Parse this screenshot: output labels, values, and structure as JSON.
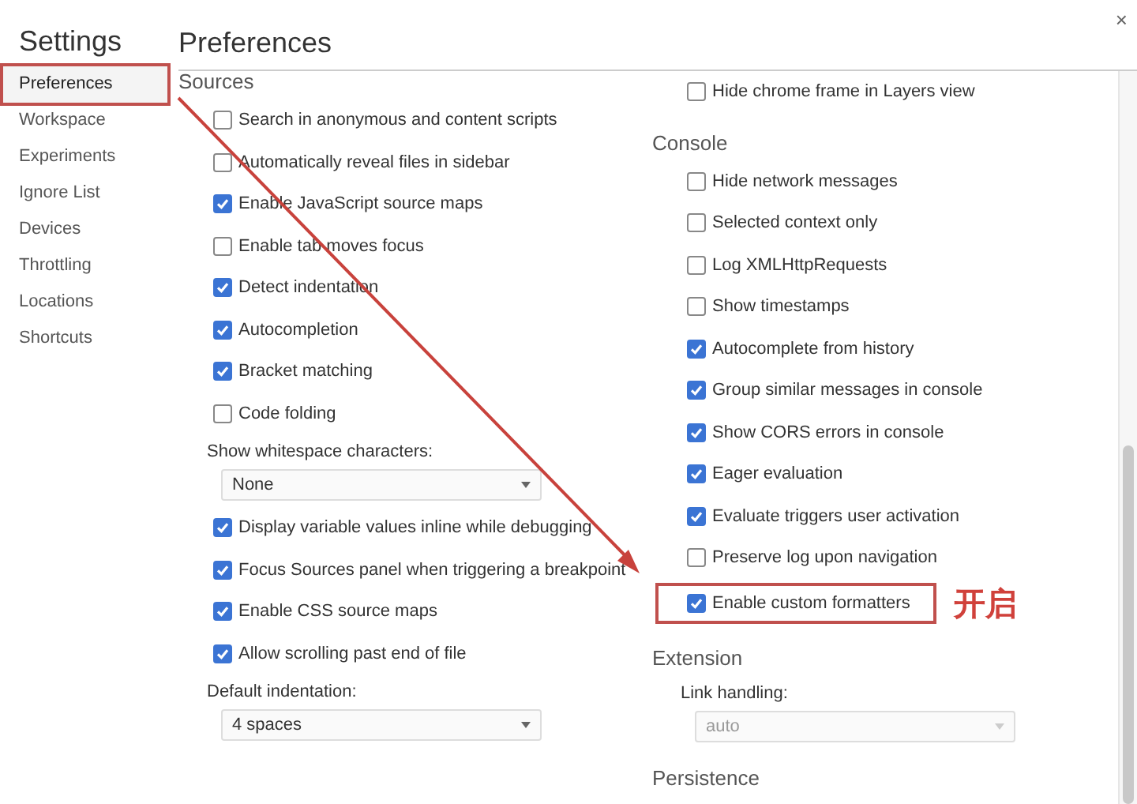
{
  "sidebar": {
    "title": "Settings",
    "items": [
      {
        "label": "Preferences",
        "selected": true,
        "highlighted": true
      },
      {
        "label": "Workspace",
        "selected": false,
        "highlighted": false
      },
      {
        "label": "Experiments",
        "selected": false,
        "highlighted": false
      },
      {
        "label": "Ignore List",
        "selected": false,
        "highlighted": false
      },
      {
        "label": "Devices",
        "selected": false,
        "highlighted": false
      },
      {
        "label": "Throttling",
        "selected": false,
        "highlighted": false
      },
      {
        "label": "Locations",
        "selected": false,
        "highlighted": false
      },
      {
        "label": "Shortcuts",
        "selected": false,
        "highlighted": false
      }
    ]
  },
  "main": {
    "title": "Preferences",
    "close": "×"
  },
  "columns": [
    [
      {
        "kind": "heading",
        "text": "Sources"
      },
      {
        "kind": "checkbox",
        "label": "Search in anonymous and content scripts",
        "checked": false
      },
      {
        "kind": "checkbox",
        "label": "Automatically reveal files in sidebar",
        "checked": false
      },
      {
        "kind": "checkbox",
        "label": "Enable JavaScript source maps",
        "checked": true
      },
      {
        "kind": "checkbox",
        "label": "Enable tab moves focus",
        "checked": false
      },
      {
        "kind": "checkbox",
        "label": "Detect indentation",
        "checked": true
      },
      {
        "kind": "checkbox",
        "label": "Autocompletion",
        "checked": true
      },
      {
        "kind": "checkbox",
        "label": "Bracket matching",
        "checked": true
      },
      {
        "kind": "checkbox",
        "label": "Code folding",
        "checked": false
      },
      {
        "kind": "select",
        "label": "Show whitespace characters:",
        "value": "None",
        "disabled": false
      },
      {
        "kind": "checkbox",
        "label": "Display variable values inline while debugging",
        "checked": true
      },
      {
        "kind": "checkbox",
        "label": "Focus Sources panel when triggering a breakpoint",
        "checked": true
      },
      {
        "kind": "checkbox",
        "label": "Enable CSS source maps",
        "checked": true
      },
      {
        "kind": "checkbox",
        "label": "Allow scrolling past end of file",
        "checked": true
      },
      {
        "kind": "select",
        "label": "Default indentation:",
        "value": "4 spaces",
        "disabled": false
      }
    ],
    [
      {
        "kind": "checkbox",
        "label": "Hide chrome frame in Layers view",
        "checked": false
      },
      {
        "kind": "heading",
        "text": "Console"
      },
      {
        "kind": "checkbox",
        "label": "Hide network messages",
        "checked": false
      },
      {
        "kind": "checkbox",
        "label": "Selected context only",
        "checked": false
      },
      {
        "kind": "checkbox",
        "label": "Log XMLHttpRequests",
        "checked": false
      },
      {
        "kind": "checkbox",
        "label": "Show timestamps",
        "checked": false
      },
      {
        "kind": "checkbox",
        "label": "Autocomplete from history",
        "checked": true
      },
      {
        "kind": "checkbox",
        "label": "Group similar messages in console",
        "checked": true
      },
      {
        "kind": "checkbox",
        "label": "Show CORS errors in console",
        "checked": true
      },
      {
        "kind": "checkbox",
        "label": "Eager evaluation",
        "checked": true
      },
      {
        "kind": "checkbox",
        "label": "Evaluate triggers user activation",
        "checked": true
      },
      {
        "kind": "checkbox",
        "label": "Preserve log upon navigation",
        "checked": false
      },
      {
        "kind": "checkbox",
        "label": "Enable custom formatters",
        "checked": true,
        "highlighted": true,
        "annotation": "开启"
      },
      {
        "kind": "heading",
        "text": "Extension"
      },
      {
        "kind": "select",
        "label": "Link handling:",
        "value": "auto",
        "disabled": true
      },
      {
        "kind": "heading",
        "text": "Persistence"
      }
    ]
  ]
}
